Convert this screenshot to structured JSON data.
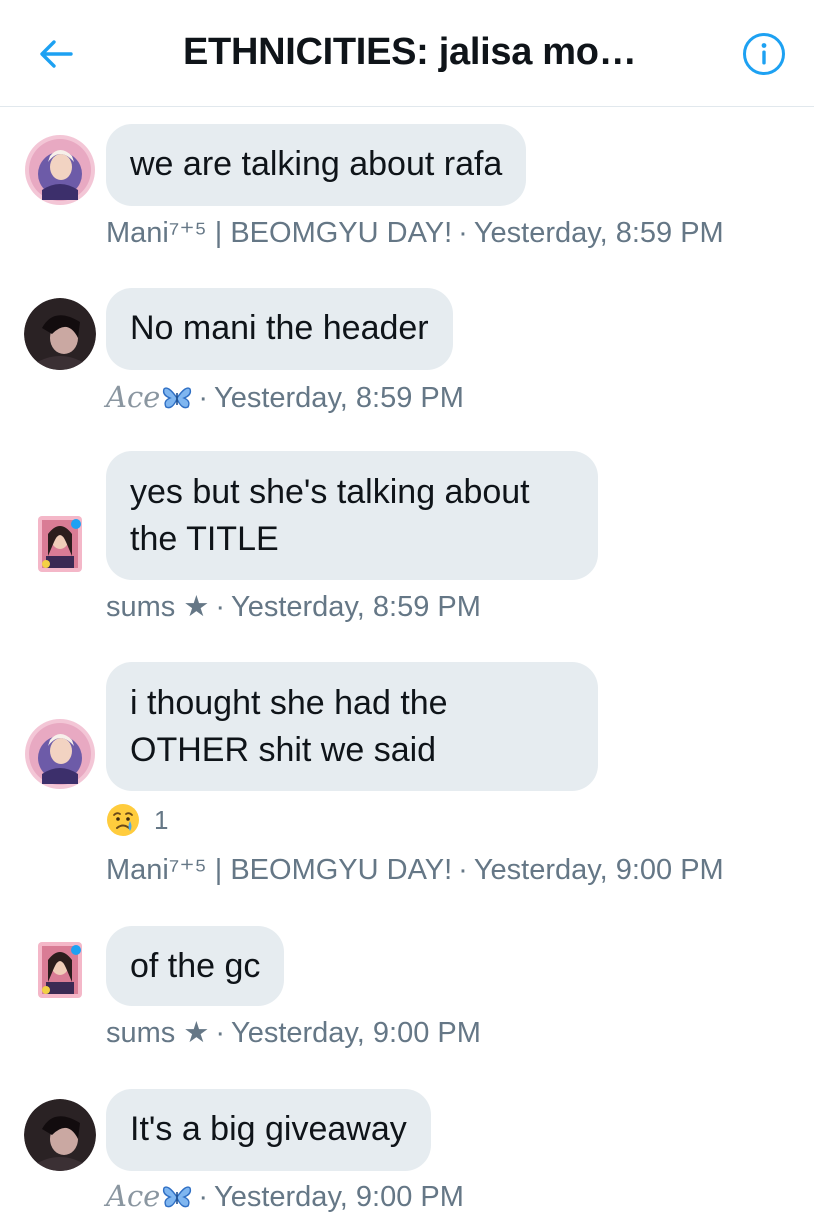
{
  "header": {
    "title": "ETHNICITIES: jalisa mo…",
    "back_icon": "arrow-left-icon",
    "info_icon": "info-circle-icon",
    "accent": "#1da1f2"
  },
  "messages": [
    {
      "text": "we are talking about rafa",
      "author": "Mani⁷⁺⁵ | BEOMGYU DAY!",
      "time": "Yesterday, 8:59 PM"
    },
    {
      "text": "No mani the header",
      "author": "Ace",
      "author_icon": "butterfly-icon",
      "time": "Yesterday, 8:59 PM"
    },
    {
      "text": "yes but she's talking about the TITLE",
      "author": "sums ★",
      "time": "Yesterday, 8:59 PM"
    },
    {
      "text": "i thought she had the OTHER shit we said",
      "reaction": {
        "emoji": "crying-face-icon",
        "count": "1"
      },
      "author": "Mani⁷⁺⁵ | BEOMGYU DAY!",
      "time": "Yesterday, 9:00 PM"
    },
    {
      "text": "of the gc",
      "author": "sums ★",
      "time": "Yesterday, 9:00 PM"
    },
    {
      "text": "It's a big giveaway",
      "author": "Ace",
      "author_icon": "butterfly-icon",
      "time": "Yesterday, 9:00 PM"
    }
  ],
  "separator": "·",
  "colors": {
    "bubble": "#e6ecf0",
    "meta": "#657786",
    "text": "#0f1419"
  }
}
